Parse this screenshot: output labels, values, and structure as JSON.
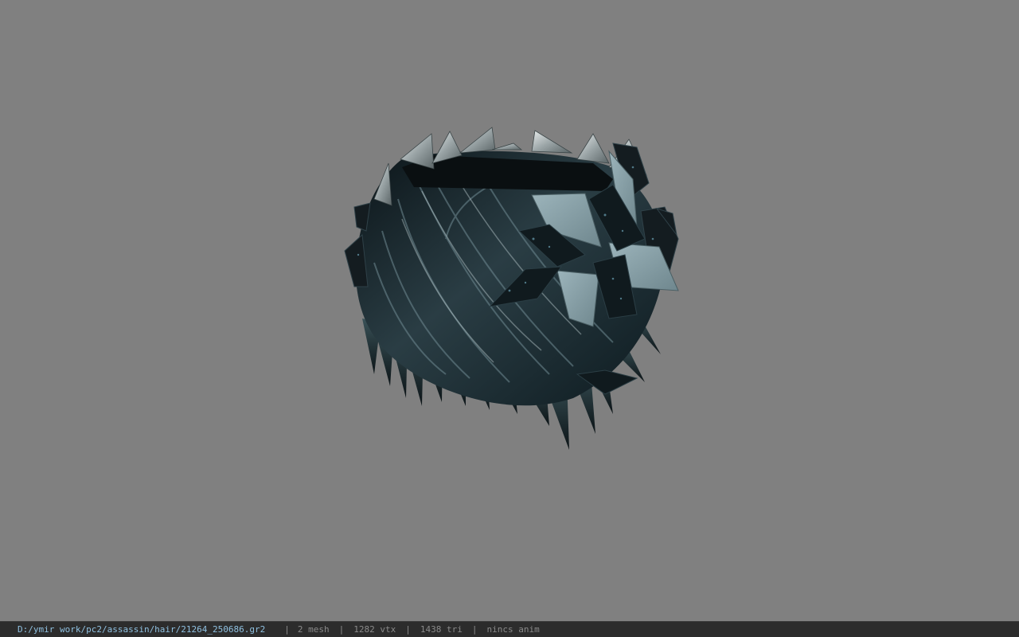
{
  "viewport": {
    "background_color": "#808080",
    "model": "hair"
  },
  "status_bar": {
    "file_path": "D:/ymir work/pc2/assassin/hair/21264_250686.gr2",
    "separator": "|",
    "mesh_count": "2 mesh",
    "vertex_count": "1282 vtx",
    "triangle_count": "1438 tri",
    "anim_status": "nincs anim",
    "path_color": "#8fc0e0",
    "text_color": "#8a8a8a",
    "background_color": "#2c2c2c"
  }
}
